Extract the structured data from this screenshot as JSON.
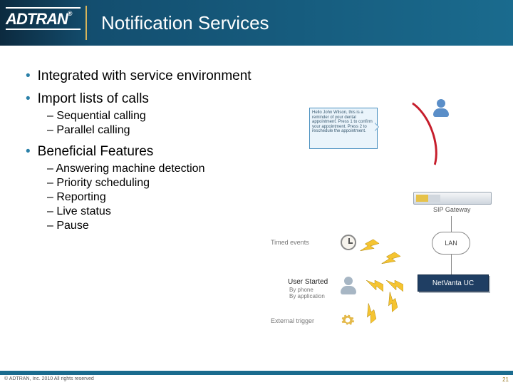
{
  "header": {
    "logo": "ADTRAN",
    "logo_tm": "®",
    "title": "Notification Services"
  },
  "bullets": {
    "b1": "Integrated with service environment",
    "b2": "Import lists of calls",
    "b2_sub": [
      "Sequential calling",
      "Parallel calling"
    ],
    "b3": "Beneficial Features",
    "b3_sub": [
      "Answering machine detection",
      "Priority scheduling",
      "Reporting",
      "Live status",
      "Pause"
    ]
  },
  "diagram": {
    "speech": "Hello John Wilson, this is a reminder of your dental appointment. Press 1 to confirm your appointment. Press 2 to reschedule the appointment.",
    "sip_gateway": "SIP Gateway",
    "timed_events": "Timed events",
    "user_started": "User Started",
    "user_started_sub1": "By phone",
    "user_started_sub2": "By application",
    "external_trigger": "External trigger",
    "lan": "LAN",
    "netvanta": "NetVanta UC"
  },
  "footer": {
    "copyright": "© ADTRAN, Inc. 2010 All rights reserved",
    "page": "21"
  }
}
